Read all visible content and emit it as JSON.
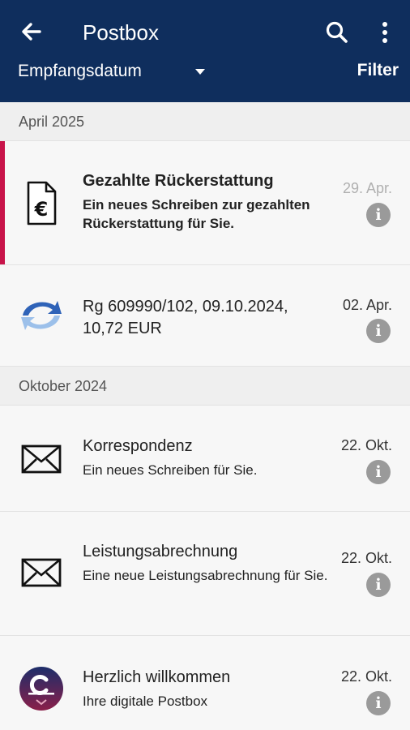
{
  "appbar": {
    "title": "Postbox",
    "sort_label": "Empfangsdatum",
    "filter_label": "Filter"
  },
  "sections": [
    {
      "header": "April 2025",
      "items": [
        {
          "icon": "euro-document-icon",
          "subject": "Gezahlte Rückerstattung",
          "preview": "Ein neues Schreiben zur gezahlten Rückerstattung für Sie.",
          "date": "29. Apr.",
          "unread": true
        },
        {
          "icon": "sync-arrows-icon",
          "subject": "Rg 609990/102, 09.10.2024, 10,72 EUR",
          "preview": "",
          "date": "02. Apr.",
          "unread": false
        }
      ]
    },
    {
      "header": "Oktober 2024",
      "items": [
        {
          "icon": "envelope-icon",
          "subject": "Korrespondenz",
          "preview": "Ein neues Schreiben für Sie.",
          "date": "22. Okt.",
          "unread": false
        },
        {
          "icon": "envelope-icon",
          "subject": "Leistungsabrechnung",
          "preview": "Eine neue Leistungsabrechnung für Sie.",
          "date": "22. Okt.",
          "unread": false
        },
        {
          "icon": "insurer-logo-icon",
          "subject": "Herzlich willkommen",
          "preview": "Ihre digitale Postbox",
          "date": "22. Okt.",
          "unread": false
        }
      ]
    }
  ],
  "info_glyph": "i",
  "colors": {
    "appbar": "#0f2e5d",
    "unread_accent": "#c8144a",
    "info_badge": "#9a9a9a"
  }
}
